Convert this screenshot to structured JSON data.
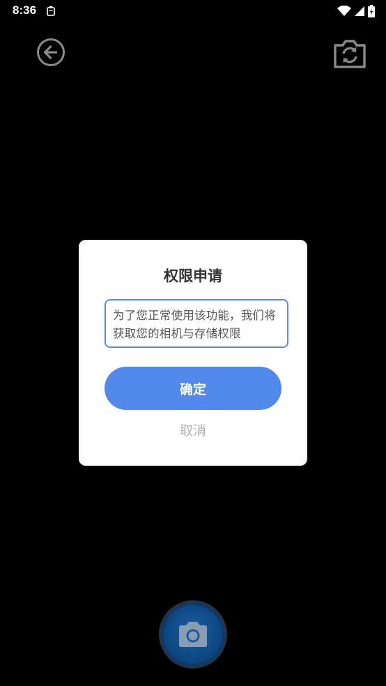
{
  "status_bar": {
    "time": "8:36",
    "notification_icon": "clipboard-icon",
    "wifi_icon": "wifi-icon",
    "signal_icon": "cell-signal-icon",
    "battery_icon": "battery-icon"
  },
  "camera": {
    "back_icon": "arrow-left-circle-icon",
    "switch_camera_icon": "camera-switch-icon",
    "shutter_icon": "camera-icon"
  },
  "dialog": {
    "title": "权限申请",
    "message": "为了您正常使用该功能，我们将获取您的相机与存储权限",
    "confirm_label": "确定",
    "cancel_label": "取消"
  },
  "colors": {
    "background": "#000000",
    "accent": "#5287ec",
    "dialog_bg": "#ffffff",
    "cancel_text": "#b3b3b3"
  }
}
